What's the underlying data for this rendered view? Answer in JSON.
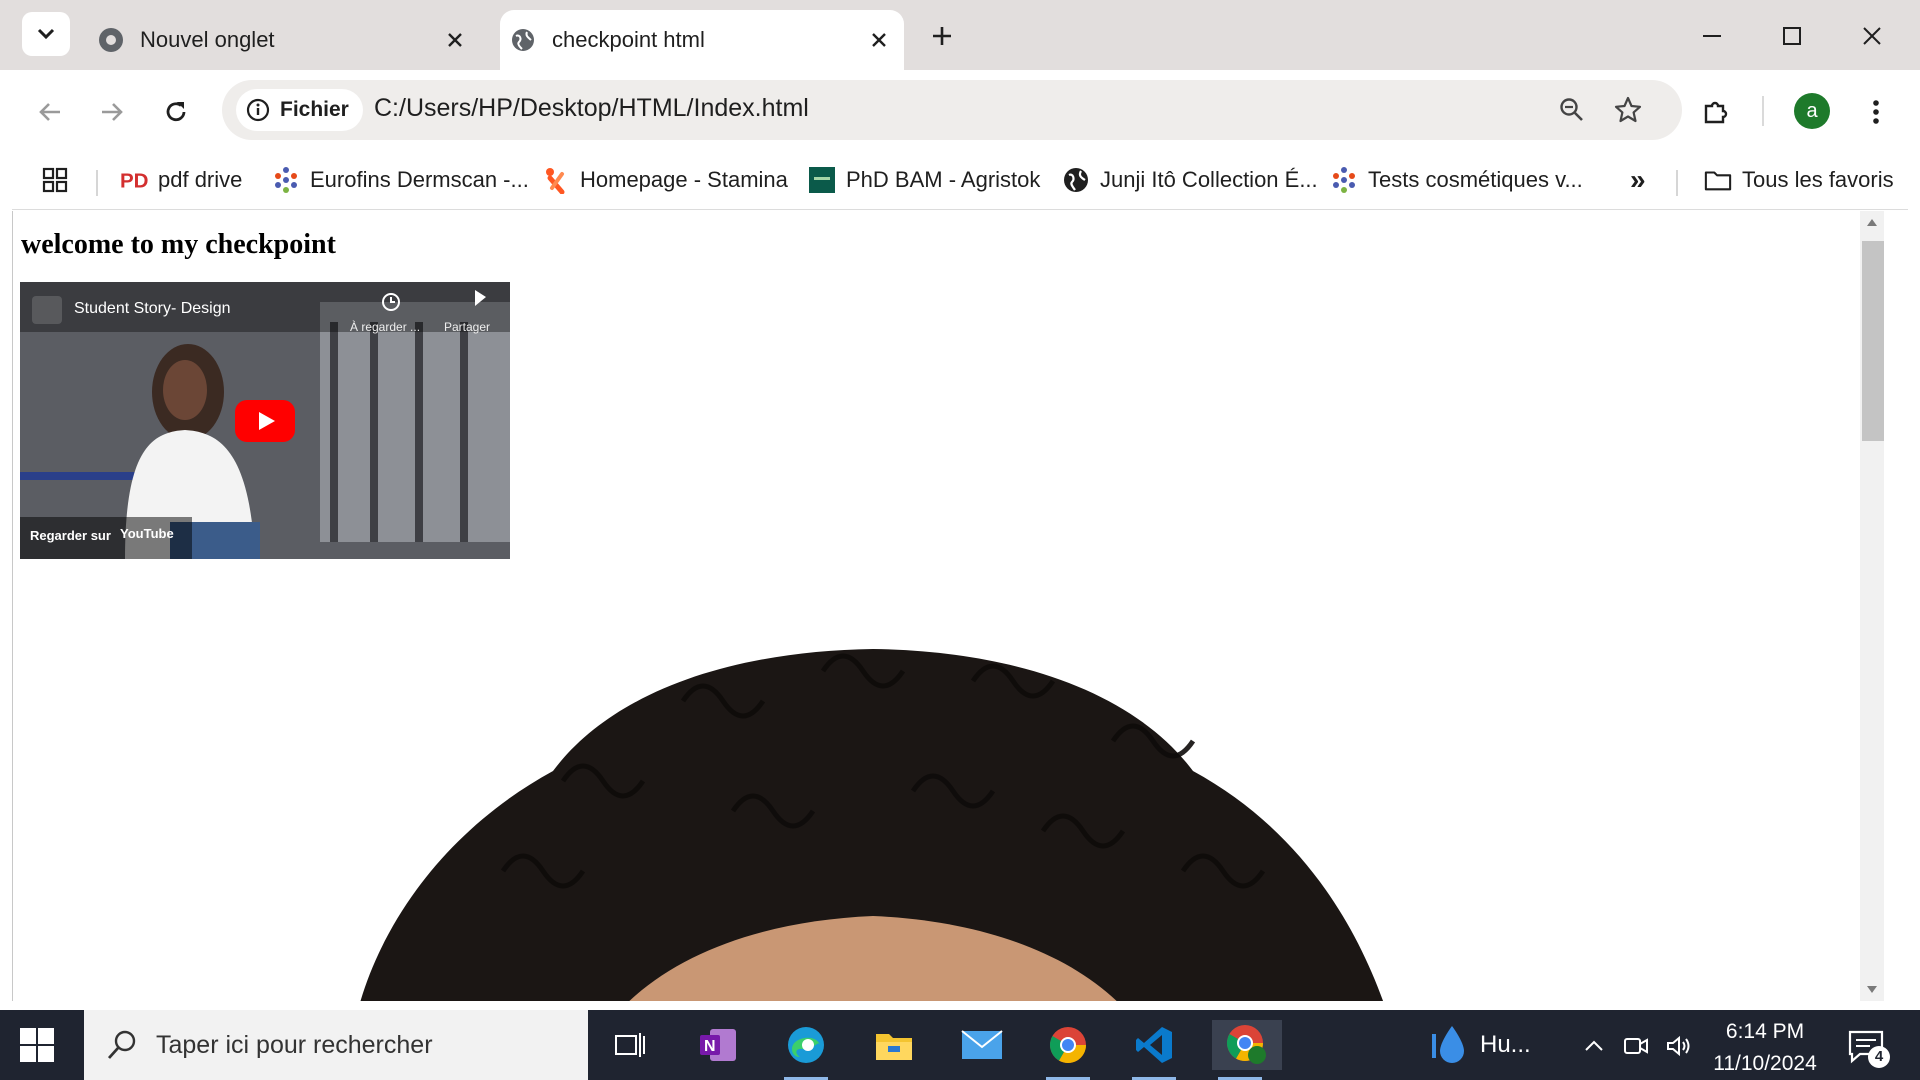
{
  "browser": {
    "tabs": [
      {
        "title": "Nouvel onglet",
        "active": false
      },
      {
        "title": "checkpoint html",
        "active": true
      }
    ],
    "address": {
      "scheme_label": "Fichier",
      "url": "C:/Users/HP/Desktop/HTML/Index.html"
    },
    "profile_initial": "a",
    "bookmarks": [
      {
        "label": "pdf drive",
        "icon": "pdf-drive-icon"
      },
      {
        "label": "Eurofins Dermscan -...",
        "icon": "eurofins-icon"
      },
      {
        "label": "Homepage - Stamina",
        "icon": "stamina-icon"
      },
      {
        "label": "PhD BAM - Agristok",
        "icon": "agristok-icon"
      },
      {
        "label": "Junji Itô Collection É...",
        "icon": "globe-icon"
      },
      {
        "label": "Tests cosmétiques v...",
        "icon": "eurofins-icon"
      }
    ],
    "overflow_label": "»",
    "all_bookmarks_label": "Tous les favoris"
  },
  "page": {
    "heading": "welcome to my checkpoint",
    "video": {
      "title": "Student Story- Design",
      "watch_later": "À regarder ...",
      "share": "Partager",
      "watch_on": "Regarder sur",
      "platform": "YouTube"
    }
  },
  "taskbar": {
    "search_placeholder": "Taper ici pour rechercher",
    "weather_label": "Hu...",
    "time": "6:14 PM",
    "date": "11/10/2024",
    "notification_count": "4"
  },
  "colors": {
    "titlebar": "#e2dedd",
    "omnibox": "#efedeb",
    "taskbar": "#1f2430",
    "avatar": "#1e7a2b",
    "youtube_red": "#ff0000"
  }
}
